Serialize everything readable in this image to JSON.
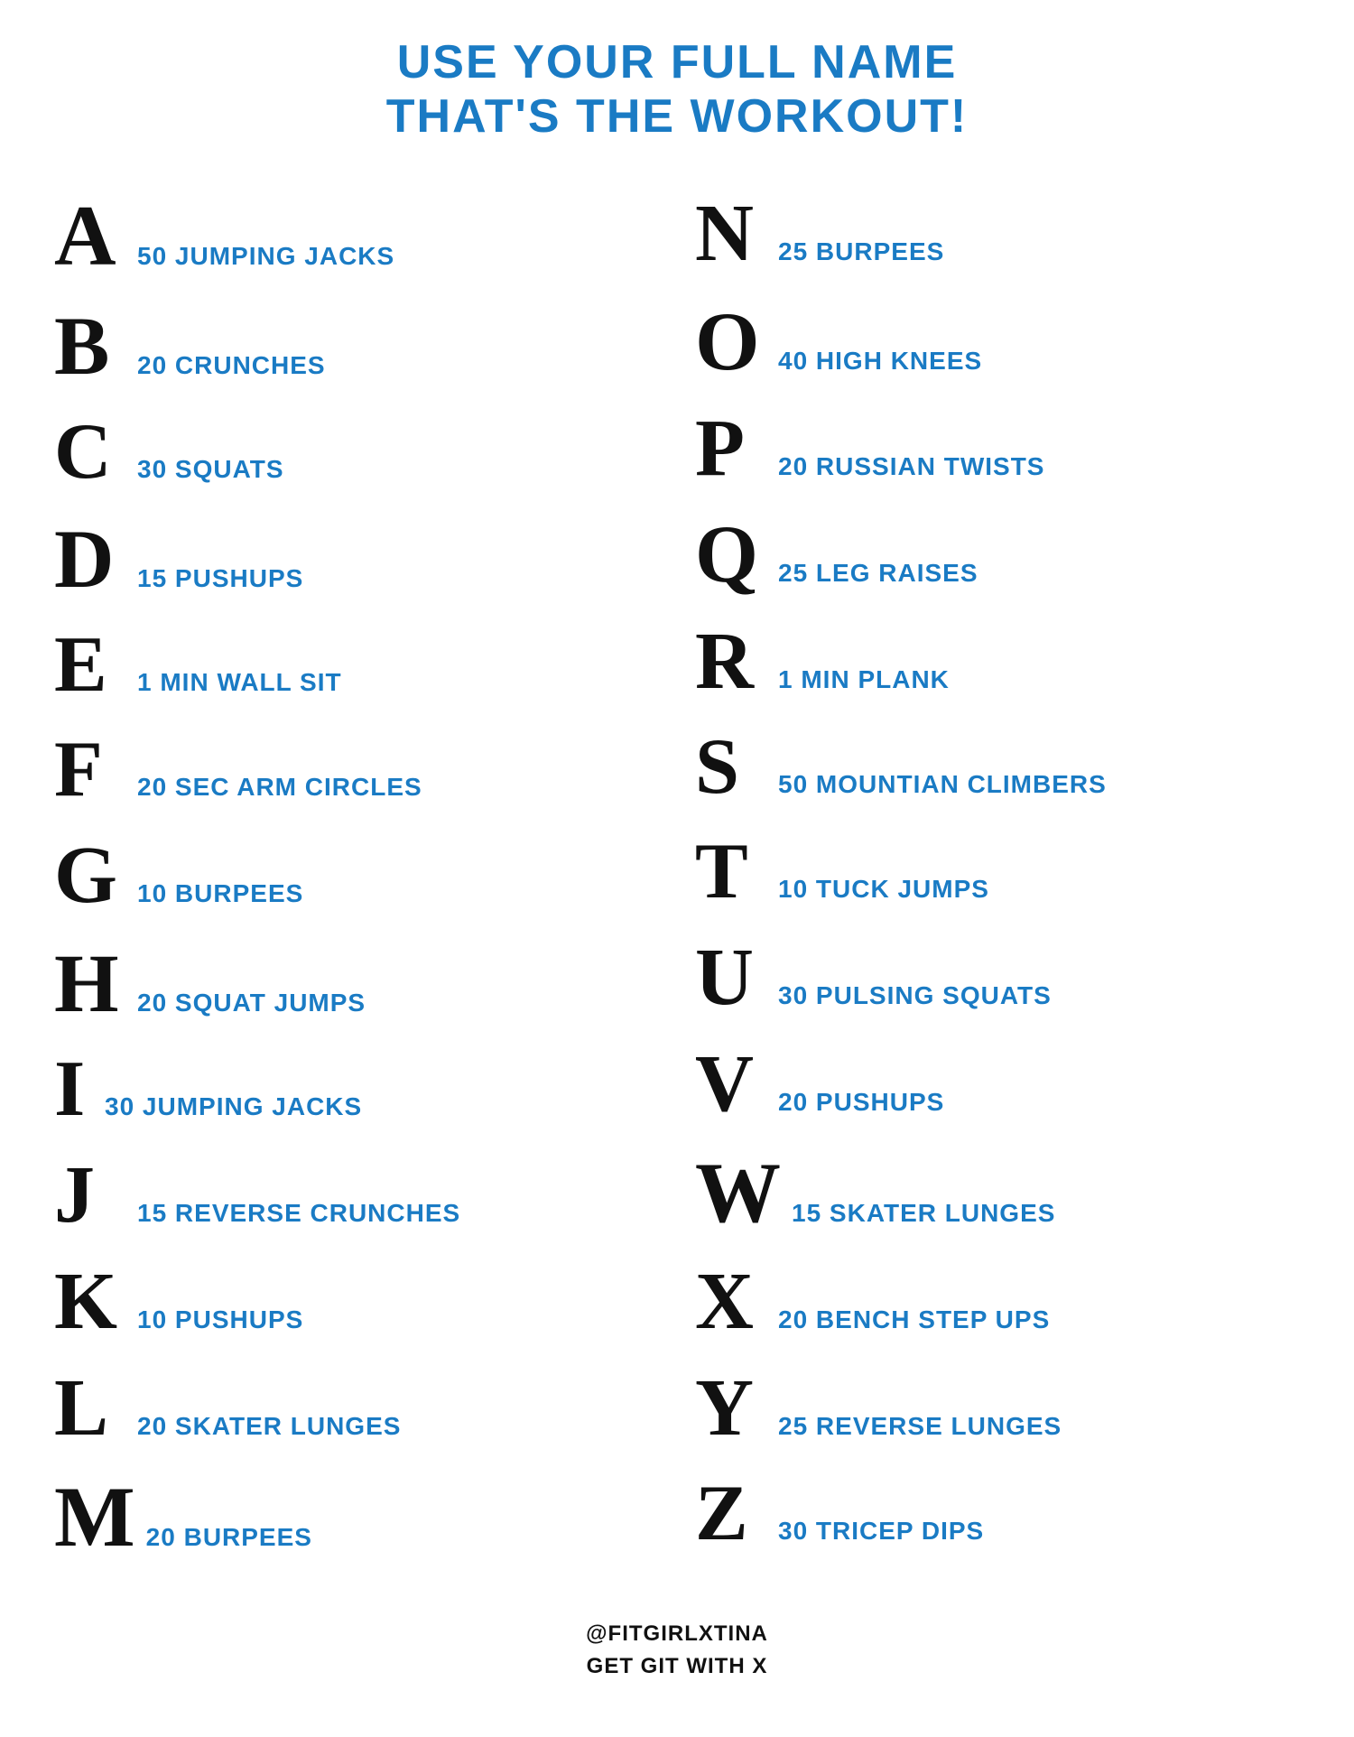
{
  "header": {
    "line1": "USE YOUR FULL NAME",
    "line2": "THAT'S THE WORKOUT!"
  },
  "left_column": [
    {
      "letter": "A",
      "exercise": "50 JUMPING JACKS"
    },
    {
      "letter": "B",
      "exercise": "20 CRUNCHES"
    },
    {
      "letter": "C",
      "exercise": "30 SQUATS"
    },
    {
      "letter": "D",
      "exercise": "15 PUSHUPS"
    },
    {
      "letter": "E",
      "exercise": "1 MIN WALL SIT"
    },
    {
      "letter": "F",
      "exercise": "20 SEC ARM CIRCLES"
    },
    {
      "letter": "G",
      "exercise": "10 BURPEES"
    },
    {
      "letter": "H",
      "exercise": "20 SQUAT JUMPS"
    },
    {
      "letter": "I",
      "exercise": "30 JUMPING JACKS"
    },
    {
      "letter": "J",
      "exercise": "15 REVERSE CRUNCHES"
    },
    {
      "letter": "K",
      "exercise": "10 PUSHUPS"
    },
    {
      "letter": "L",
      "exercise": "20 SKATER LUNGES"
    },
    {
      "letter": "M",
      "exercise": "20 BURPEES"
    }
  ],
  "right_column": [
    {
      "letter": "N",
      "exercise": "25 BURPEES"
    },
    {
      "letter": "O",
      "exercise": "40 HIGH KNEES"
    },
    {
      "letter": "P",
      "exercise": "20 RUSSIAN TWISTS"
    },
    {
      "letter": "Q",
      "exercise": "25 LEG RAISES"
    },
    {
      "letter": "R",
      "exercise": "1 MIN PLANK"
    },
    {
      "letter": "S",
      "exercise": "50 MOUNTIAN CLIMBERS"
    },
    {
      "letter": "T",
      "exercise": "10 TUCK JUMPS"
    },
    {
      "letter": "U",
      "exercise": "30 PULSING SQUATS"
    },
    {
      "letter": "V",
      "exercise": "20 PUSHUPS"
    },
    {
      "letter": "W",
      "exercise": "15 SKATER LUNGES"
    },
    {
      "letter": "X",
      "exercise": "20 BENCH STEP UPS"
    },
    {
      "letter": "Y",
      "exercise": "25 REVERSE LUNGES"
    },
    {
      "letter": "Z",
      "exercise": "30 TRICEP DIPS"
    }
  ],
  "footer": {
    "line1": "@FITGIRLXTINA",
    "line2": "GET GIT WITH X"
  },
  "colors": {
    "accent": "#1a7bc4",
    "text": "#111111",
    "background": "#ffffff"
  }
}
